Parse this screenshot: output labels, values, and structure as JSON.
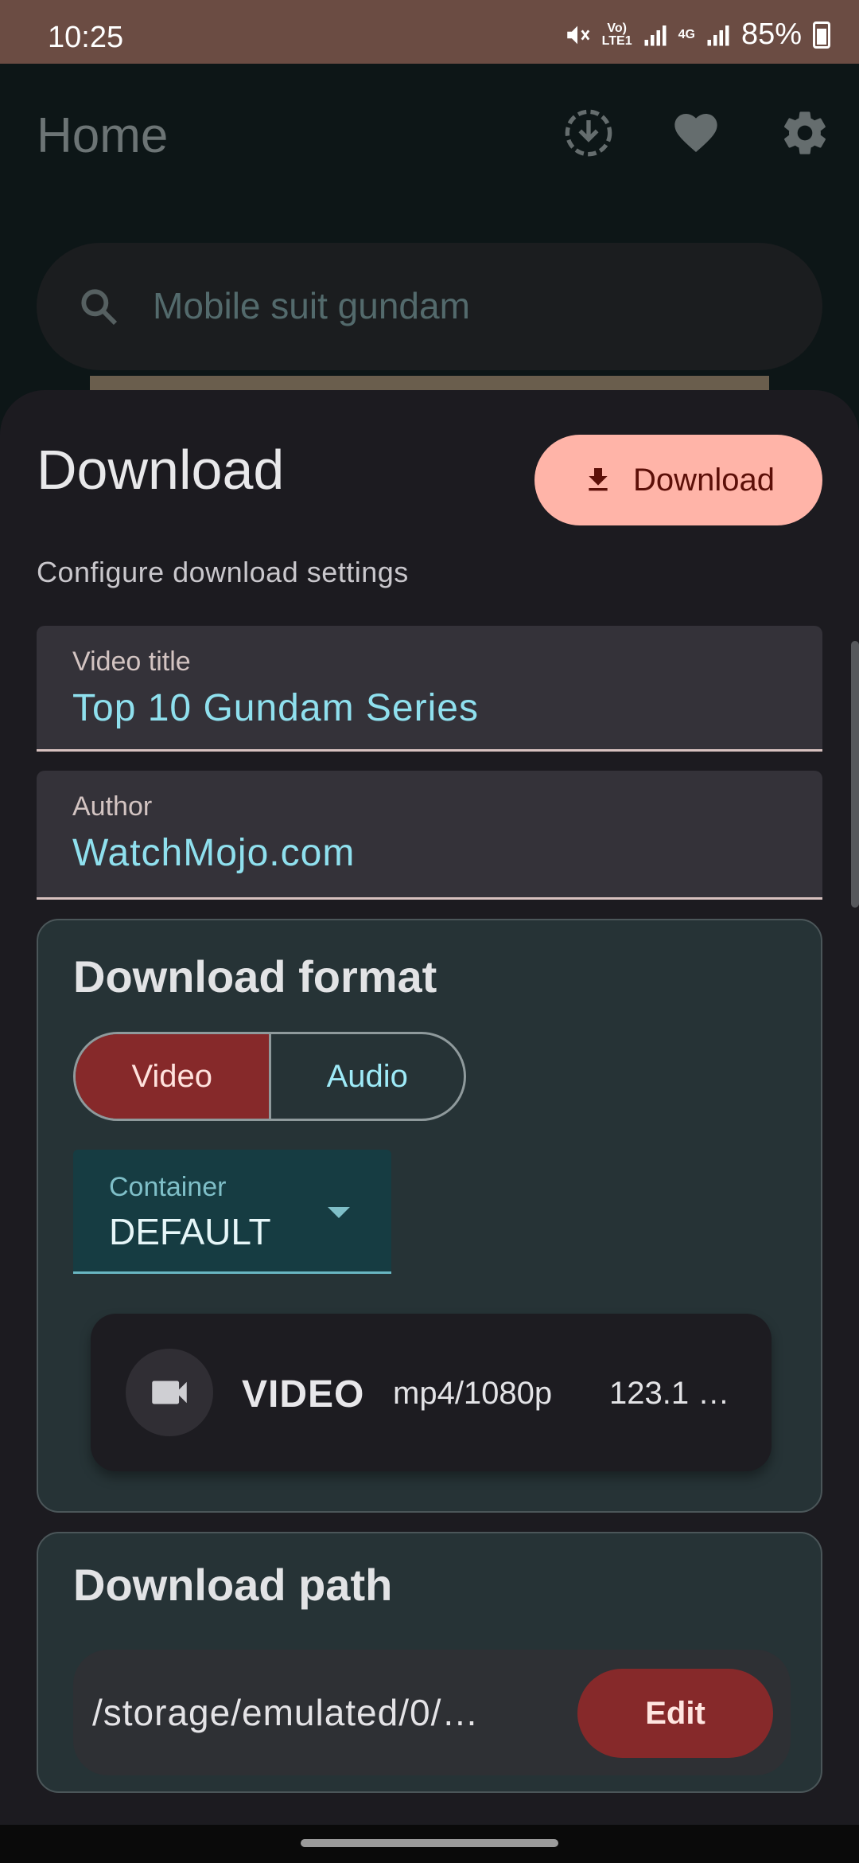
{
  "status_bar": {
    "time": "10:25",
    "battery": "85%",
    "network_vol": "Vo)",
    "network_lte": "LTE1",
    "network_4g": "4G"
  },
  "app": {
    "title": "Home",
    "search_placeholder": "Mobile suit gundam"
  },
  "sheet": {
    "title": "Download",
    "subtitle": "Configure download settings",
    "download_button": "Download",
    "video_title_label": "Video title",
    "video_title_value": "Top 10 Gundam Series",
    "author_label": "Author",
    "author_value": "WatchMojo.com",
    "format_card": {
      "title": "Download format",
      "options": [
        "Video",
        "Audio"
      ],
      "selected": "Video",
      "container_label": "Container",
      "container_value": "DEFAULT",
      "stream": {
        "type": "VIDEO",
        "spec": "mp4/1080p",
        "size": "123.1 …"
      }
    },
    "path_card": {
      "title": "Download path",
      "path": "/storage/emulated/0/…",
      "edit_button": "Edit"
    }
  },
  "colors": {
    "status_bar": "#6b4c43",
    "primary_container": "#ffb4a8",
    "accent_red": "#86292a",
    "accent_cyan": "#8fe0ee",
    "card_bg": "#263336"
  }
}
